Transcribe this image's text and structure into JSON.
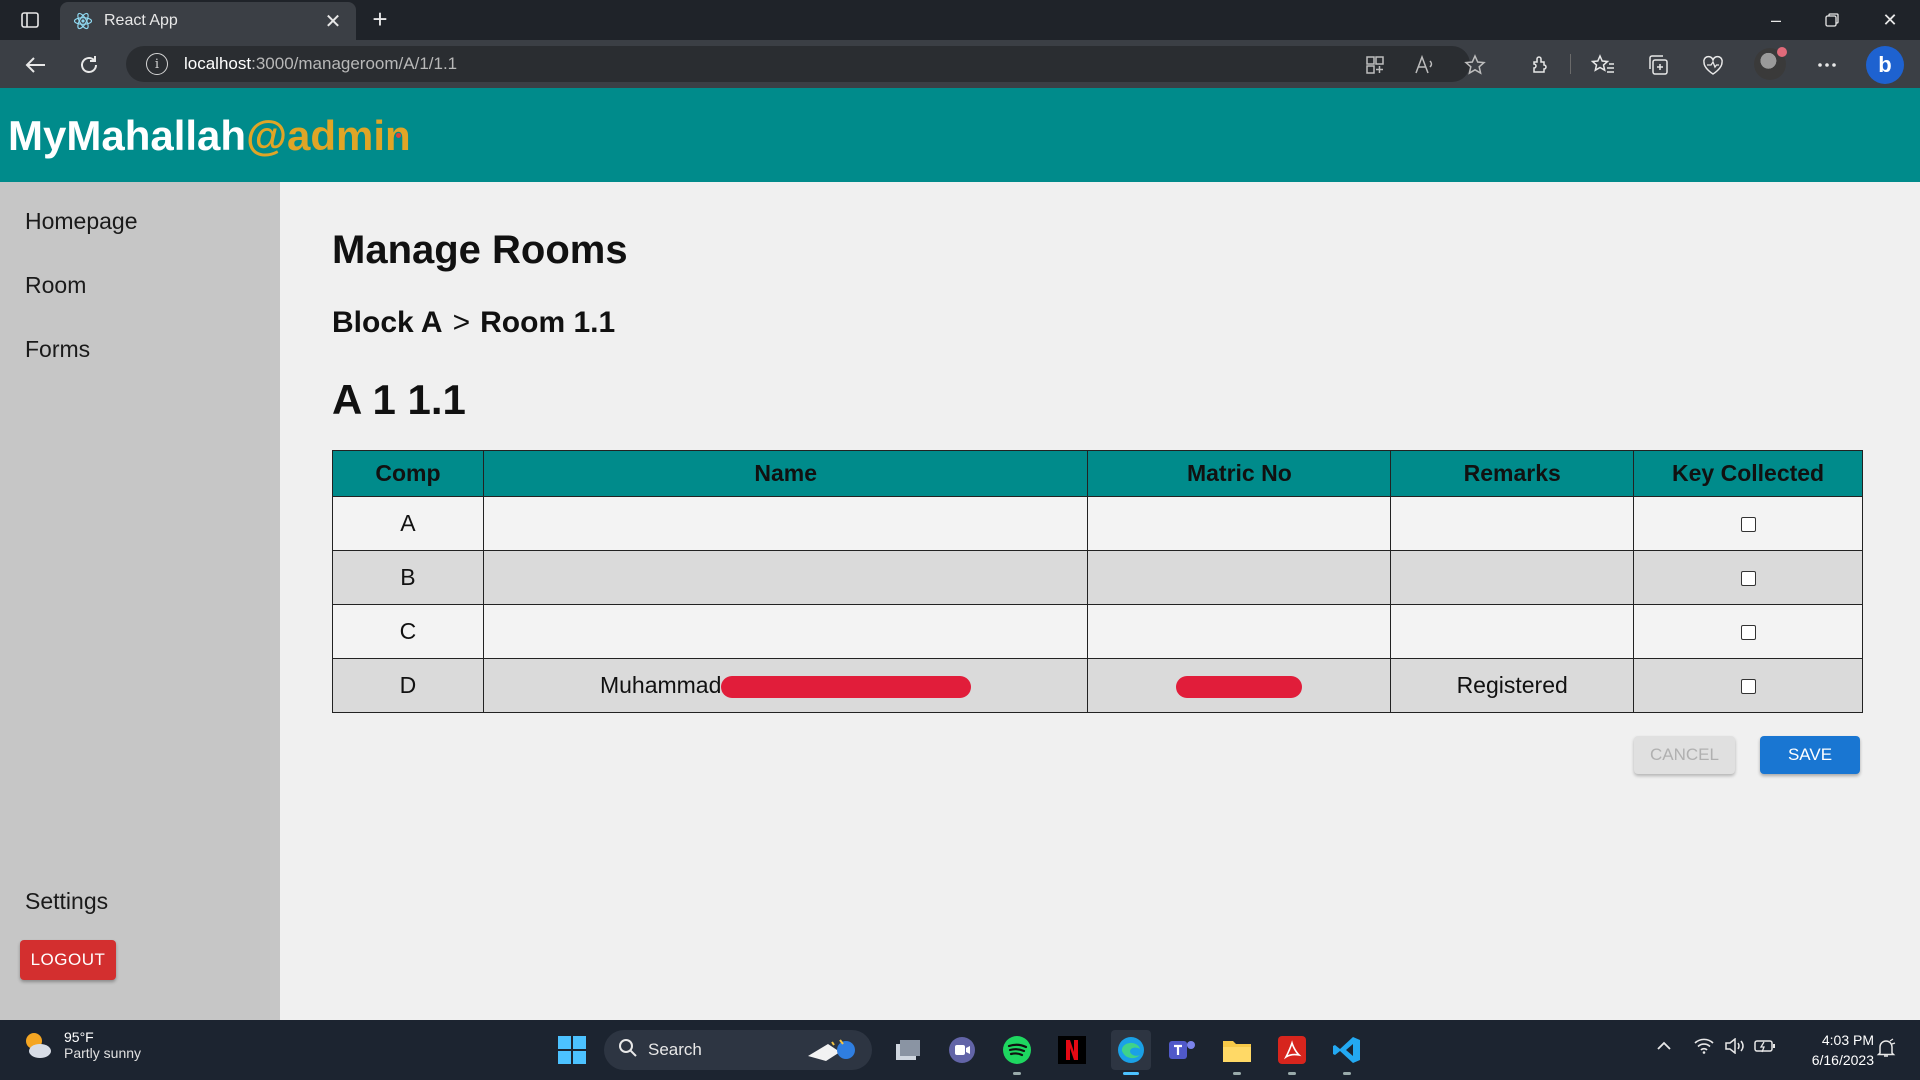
{
  "browser": {
    "tab_title": "React App",
    "url_host": "localhost",
    "url_path": ":3000/manageroom/A/1/1.1"
  },
  "app": {
    "brand_main": "MyMahallah",
    "brand_suffix": "@admin"
  },
  "sidebar": {
    "items": [
      {
        "label": "Homepage"
      },
      {
        "label": "Room"
      },
      {
        "label": "Forms"
      }
    ],
    "settings_label": "Settings",
    "logout_label": "LOGOUT"
  },
  "main": {
    "title": "Manage Rooms",
    "breadcrumb": {
      "block": "Block A",
      "separator": ">",
      "room": "Room 1.1"
    },
    "room_code": "A 1 1.1",
    "table": {
      "headers": [
        "Comp",
        "Name",
        "Matric No",
        "Remarks",
        "Key Collected"
      ],
      "rows": [
        {
          "comp": "A",
          "name": "",
          "matric_no": "",
          "remarks": "",
          "key_collected": false
        },
        {
          "comp": "B",
          "name": "",
          "matric_no": "",
          "remarks": "",
          "key_collected": false
        },
        {
          "comp": "C",
          "name": "",
          "matric_no": "",
          "remarks": "",
          "key_collected": false
        },
        {
          "comp": "D",
          "name": "Muhammad",
          "matric_no": "",
          "remarks": "Registered",
          "key_collected": false
        }
      ]
    },
    "cancel_label": "CANCEL",
    "save_label": "SAVE"
  },
  "taskbar": {
    "weather_temp": "95°F",
    "weather_condition": "Partly sunny",
    "search_label": "Search",
    "time": "4:03 PM",
    "date": "6/16/2023"
  },
  "colors": {
    "header_teal": "#008b8b",
    "brand_accent": "#e0a526",
    "logout_red": "#d32f2f",
    "save_blue": "#1976d2",
    "redaction_red": "#e11d3a"
  }
}
